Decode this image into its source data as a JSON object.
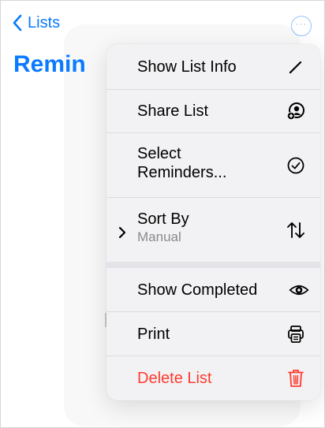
{
  "nav": {
    "back_label": "Lists",
    "more_label": "···"
  },
  "page": {
    "title": "Remin"
  },
  "menu": {
    "show_list_info": "Show List Info",
    "share_list": "Share List",
    "select_reminders_line1": "Select",
    "select_reminders_line2": "Reminders...",
    "sort_by": "Sort By",
    "sort_by_value": "Manual",
    "show_completed": "Show Completed",
    "print": "Print",
    "delete_list": "Delete List"
  },
  "icons": {
    "back": "chevron-left-icon",
    "more": "ellipsis-circle-icon",
    "show_list_info": "pencil-icon",
    "share_list": "person-plus-icon",
    "select_reminders": "checkmark-circle-icon",
    "sort_by": "arrow-up-down-icon",
    "show_completed": "eye-icon",
    "print": "printer-icon",
    "delete_list": "trash-icon"
  },
  "colors": {
    "accent": "#0a7aff",
    "destructive": "#ff3b30",
    "menu_background": "#f2f2f4",
    "secondary_text": "#8a8a8e"
  }
}
